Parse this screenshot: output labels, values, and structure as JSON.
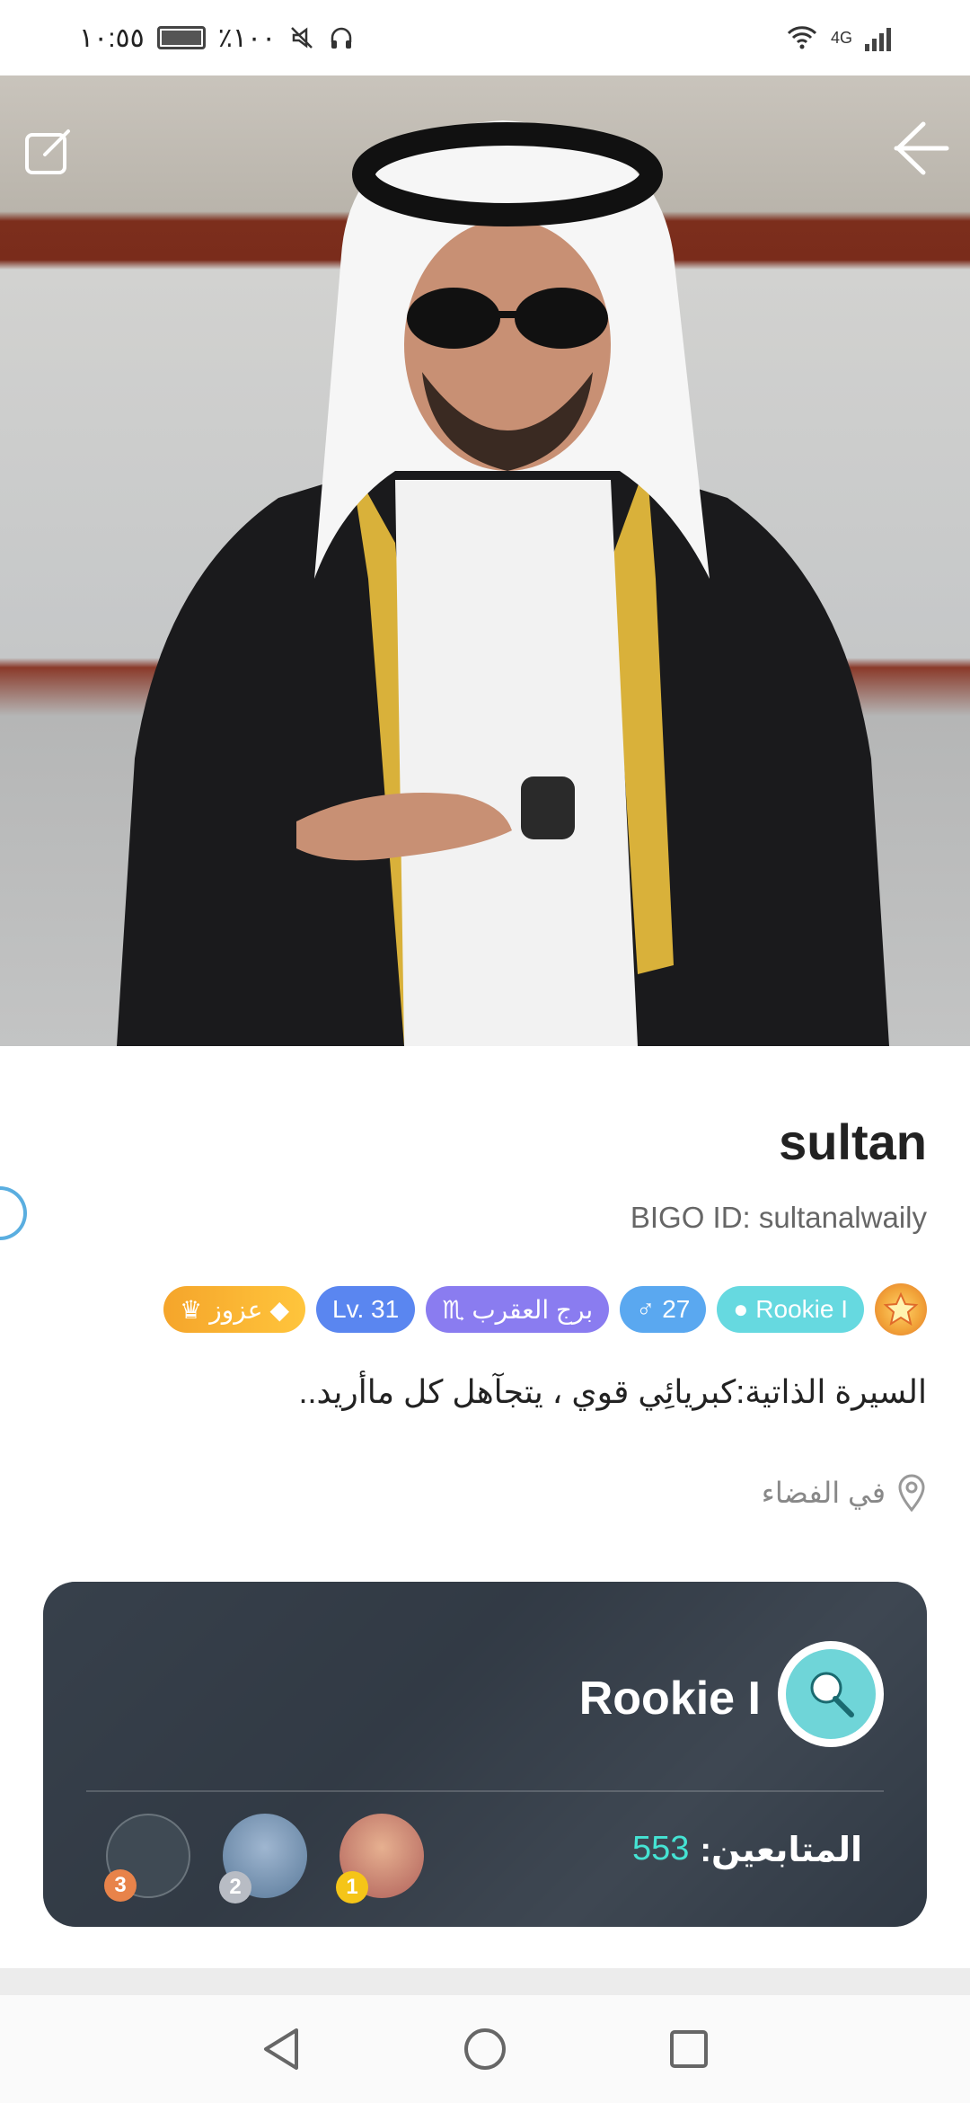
{
  "status_bar": {
    "time": "١٠:٥٥",
    "battery_text": "٪١٠٠",
    "network_label": "4G"
  },
  "profile": {
    "name": "sultan",
    "bigo_id": "BIGO ID: sultanalwaily",
    "badges": {
      "rookie": "Rookie I",
      "age": "27",
      "zodiac": "برج العقرب",
      "level": "Lv. 31",
      "family": "عزوز"
    },
    "bio": "السيرة الذاتية:كبريائِي قوي ، يتجآهل كل ماأريد..",
    "location": "في الفضاء"
  },
  "rookie_card": {
    "title": "Rookie I",
    "followers_label": "المتابعين:",
    "followers_count": "553",
    "fans": [
      {
        "rank": "1",
        "color": "#f5c518"
      },
      {
        "rank": "2",
        "color": "#b8bcc4"
      },
      {
        "rank": "3",
        "color": "#e8834a"
      }
    ]
  },
  "colors": {
    "accent_teal": "#45e3d3",
    "rookie_badge": "#66d9e0",
    "level_badge": "#5a86f0",
    "zodiac_badge": "#8a7cf0",
    "age_badge": "#5aa8f0",
    "family_badge": "#f5a52b"
  }
}
